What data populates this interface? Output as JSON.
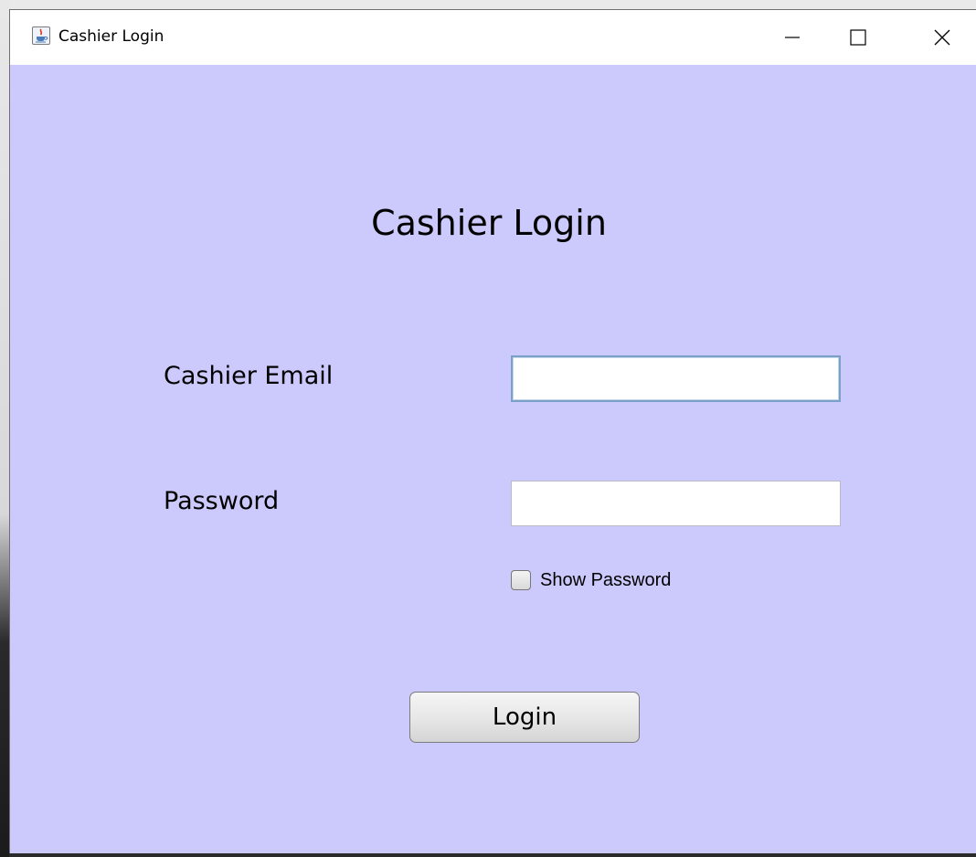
{
  "window": {
    "title": "Cashier Login",
    "icons": {
      "app": "java-app-icon",
      "minimize": "minimize-icon",
      "maximize": "maximize-icon",
      "close": "close-icon"
    }
  },
  "form": {
    "heading": "Cashier Login",
    "email_label": "Cashier Email",
    "email_value": "",
    "password_label": "Password",
    "password_value": "",
    "show_password_label": "Show Password",
    "show_password_checked": false,
    "login_label": "Login"
  },
  "colors": {
    "background": "#cccafd",
    "titlebar": "#ffffff",
    "focus_border": "#7a9fc9"
  }
}
